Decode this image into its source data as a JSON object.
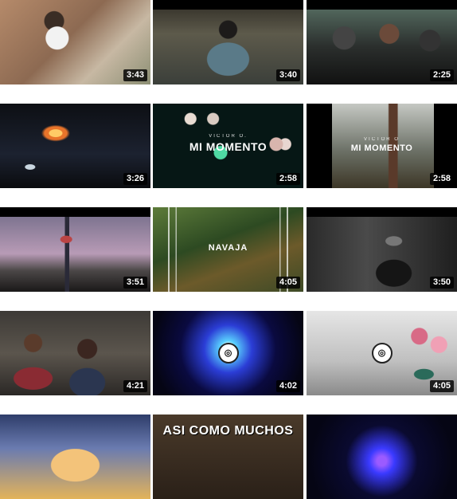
{
  "videos": [
    {
      "duration": "3:43"
    },
    {
      "duration": "3:40"
    },
    {
      "duration": "2:25"
    },
    {
      "duration": "3:26"
    },
    {
      "duration": "2:58",
      "credit": "VICTOR O.",
      "title": "MI MOMENTO"
    },
    {
      "duration": "2:58",
      "credit": "VICTOR O",
      "title": "MI MOMENTO"
    },
    {
      "duration": "3:51"
    },
    {
      "duration": "4:05",
      "brand": "NAVAJA"
    },
    {
      "duration": "3:50"
    },
    {
      "duration": "4:21"
    },
    {
      "duration": "4:02"
    },
    {
      "duration": "4:05"
    },
    {},
    {
      "poster_text": "ASI COMO MUCHOS"
    },
    {}
  ],
  "colors": {
    "duration_bg": "#000000",
    "duration_text": "#ffffff",
    "page_bg": "#ffffff"
  }
}
